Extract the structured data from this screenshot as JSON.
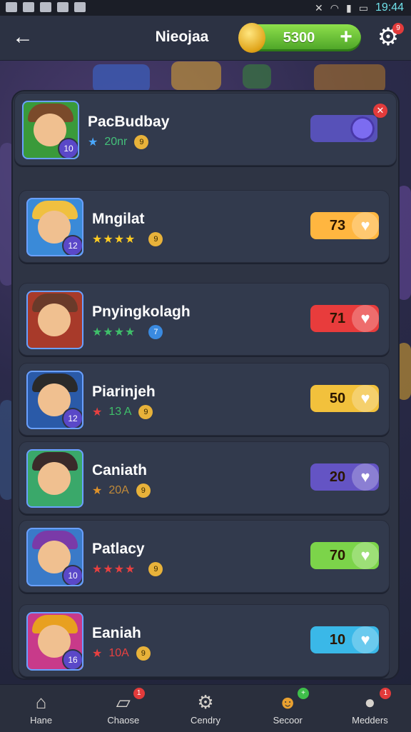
{
  "status": {
    "time": "19:44"
  },
  "header": {
    "title": "Nieojaa",
    "coins": "5300",
    "plus": "+",
    "gear_badge": "9"
  },
  "rows": [
    {
      "name": "PacBudbay",
      "level": "10",
      "stars": "★",
      "meta": "20nr",
      "star_color": "#4aa8ff",
      "meta_color": "#44c07a",
      "medal": "9",
      "kind": "toggle"
    },
    {
      "name": "Mngilat",
      "level": "12",
      "stars": "★★★★",
      "meta": "",
      "star_color": "#ffcc22",
      "meta_color": "#ffcc22",
      "medal": "9",
      "kind": "pill",
      "value": "73",
      "pill_color": "#ffb640"
    },
    {
      "name": "Pnyingkolagh",
      "level": "",
      "stars": "★★★★",
      "meta": "",
      "star_color": "#3fbf6a",
      "meta_color": "#3fbf6a",
      "medal": "7",
      "kind": "pill",
      "value": "71",
      "pill_color": "#e83c3c"
    },
    {
      "name": "Piarinjeh",
      "level": "12",
      "stars": "★",
      "meta": "13 A",
      "star_color": "#e84040",
      "meta_color": "#3fbf6a",
      "medal": "9",
      "kind": "pill",
      "value": "50",
      "pill_color": "#f2c13c"
    },
    {
      "name": "Caniath",
      "level": "",
      "stars": "★",
      "meta": "20A",
      "star_color": "#e0922a",
      "meta_color": "#c08a3a",
      "medal": "9",
      "kind": "pill",
      "value": "20",
      "pill_color": "#6454c4"
    },
    {
      "name": "Patlacy",
      "level": "10",
      "stars": "★★★★",
      "meta": "",
      "star_color": "#e84040",
      "meta_color": "#e84040",
      "medal": "9",
      "kind": "pill",
      "value": "70",
      "pill_color": "#7cd44a"
    },
    {
      "name": "Eaniah",
      "level": "16",
      "stars": "★",
      "meta": "10A",
      "star_color": "#e84040",
      "meta_color": "#e84040",
      "medal": "9",
      "kind": "pill",
      "value": "10",
      "pill_color": "#3ab8e8"
    }
  ],
  "nav": [
    {
      "label": "Hane",
      "icon": "home-icon",
      "badge": ""
    },
    {
      "label": "Chaose",
      "icon": "cards-icon",
      "badge": "1"
    },
    {
      "label": "Cendry",
      "icon": "gear-tool-icon",
      "badge": ""
    },
    {
      "label": "Secoor",
      "icon": "creature-icon",
      "badge": "+"
    },
    {
      "label": "Medders",
      "icon": "chat-icon",
      "badge": "1"
    }
  ]
}
